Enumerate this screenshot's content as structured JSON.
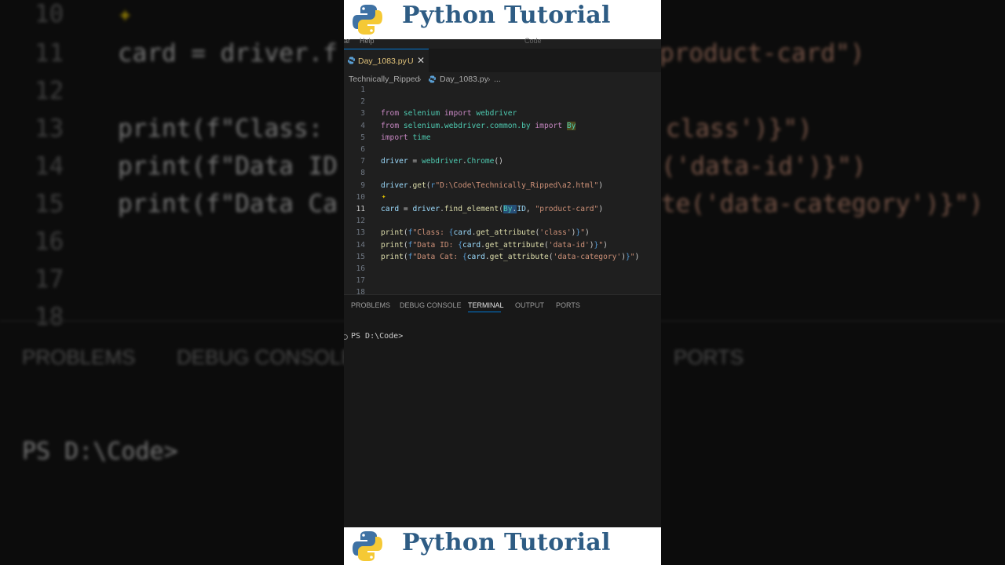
{
  "background": {
    "lines": [
      {
        "n": "10",
        "code": ""
      },
      {
        "n": "11",
        "code": "card = driver.f"
      },
      {
        "n": "12",
        "code": ""
      },
      {
        "n": "13",
        "code": "print(f\"Class: "
      },
      {
        "n": "14",
        "code": "print(f\"Data ID"
      },
      {
        "n": "15",
        "code": "print(f\"Data Ca"
      },
      {
        "n": "16",
        "code": ""
      },
      {
        "n": "17",
        "code": ""
      },
      {
        "n": "18",
        "code": ""
      }
    ],
    "right_lines": [
      "product-card\")",
      "class')}\")",
      "('data-id')}\")",
      "te('data-category')}\")"
    ],
    "tabs": [
      "PROBLEMS",
      "DEBUG CONSOLE",
      "PORTS"
    ],
    "prompt": "PS D:\\Code>"
  },
  "banner": {
    "title": "Python Tutorial"
  },
  "menubar": {
    "items": [
      "ar",
      "Help",
      "Code"
    ]
  },
  "tab": {
    "filename": "Day_1083.py",
    "status": "U",
    "close": "✕"
  },
  "breadcrumb": {
    "folder": "Technically_Ripped",
    "file": "Day_1083.py",
    "more": "..."
  },
  "editor": {
    "lines": [
      {
        "n": "1",
        "html": ""
      },
      {
        "n": "2",
        "html": ""
      },
      {
        "n": "3",
        "html": "<span class=\"kw\">from</span> <span class=\"mod\">selenium</span> <span class=\"kw\">import</span> <span class=\"mod\">webdriver</span>"
      },
      {
        "n": "4",
        "html": "<span class=\"kw\">from</span> <span class=\"mod\">selenium.webdriver.common.by</span> <span class=\"kw\">import</span> <span class=\"mod hl\">By</span>"
      },
      {
        "n": "5",
        "html": "<span class=\"kw\">import</span> <span class=\"mod\">time</span>"
      },
      {
        "n": "6",
        "html": ""
      },
      {
        "n": "7",
        "html": "<span class=\"var\">driver</span> = <span class=\"mod\">webdriver</span>.<span class=\"mod\">Chrome</span>()"
      },
      {
        "n": "8",
        "html": ""
      },
      {
        "n": "9",
        "html": "<span class=\"var\">driver</span>.<span class=\"fn\">get</span>(<span class=\"brace\">r</span><span class=\"str\">\"D:\\Code\\Technically_Ripped\\a2.html\"</span>)"
      },
      {
        "n": "10",
        "html": ""
      },
      {
        "n": "11",
        "html": "<span class=\"var\">card</span> = <span class=\"var\">driver</span>.<span class=\"fn\">find_element</span>(<span class=\"mod sel\">By</span><span class=\"sel\">.</span><span class=\"var\">ID</span>, <span class=\"str\">\"product-card\"</span>)",
        "active": true
      },
      {
        "n": "12",
        "html": ""
      },
      {
        "n": "13",
        "html": "<span class=\"fn\">print</span>(<span class=\"brace\">f</span><span class=\"str\">\"Class: </span><span class=\"brace\">{</span><span class=\"var\">card</span>.<span class=\"fn\">get_attribute</span>(<span class=\"str\">'class'</span>)<span class=\"brace\">}</span><span class=\"str\">\"</span>)"
      },
      {
        "n": "14",
        "html": "<span class=\"fn\">print</span>(<span class=\"brace\">f</span><span class=\"str\">\"Data ID: </span><span class=\"brace\">{</span><span class=\"var\">card</span>.<span class=\"fn\">get_attribute</span>(<span class=\"str\">'data-id'</span>)<span class=\"brace\">}</span><span class=\"str\">\"</span>)"
      },
      {
        "n": "15",
        "html": "<span class=\"fn\">print</span>(<span class=\"brace\">f</span><span class=\"str\">\"Data Cat: </span><span class=\"brace\">{</span><span class=\"var\">card</span>.<span class=\"fn\">get_attribute</span>(<span class=\"str\">'data-category'</span>)<span class=\"brace\">}</span><span class=\"str\">\"</span>)"
      },
      {
        "n": "16",
        "html": ""
      },
      {
        "n": "17",
        "html": ""
      },
      {
        "n": "18",
        "html": ""
      }
    ]
  },
  "panel": {
    "tabs": [
      "PROBLEMS",
      "DEBUG CONSOLE",
      "TERMINAL",
      "OUTPUT",
      "PORTS"
    ],
    "active": "TERMINAL",
    "prompt": "PS D:\\Code>"
  },
  "colors": {
    "accent": "#0078d4",
    "banner_text": "#2e5c84",
    "python_blue": "#3f72a4",
    "python_yellow": "#f5c935"
  }
}
